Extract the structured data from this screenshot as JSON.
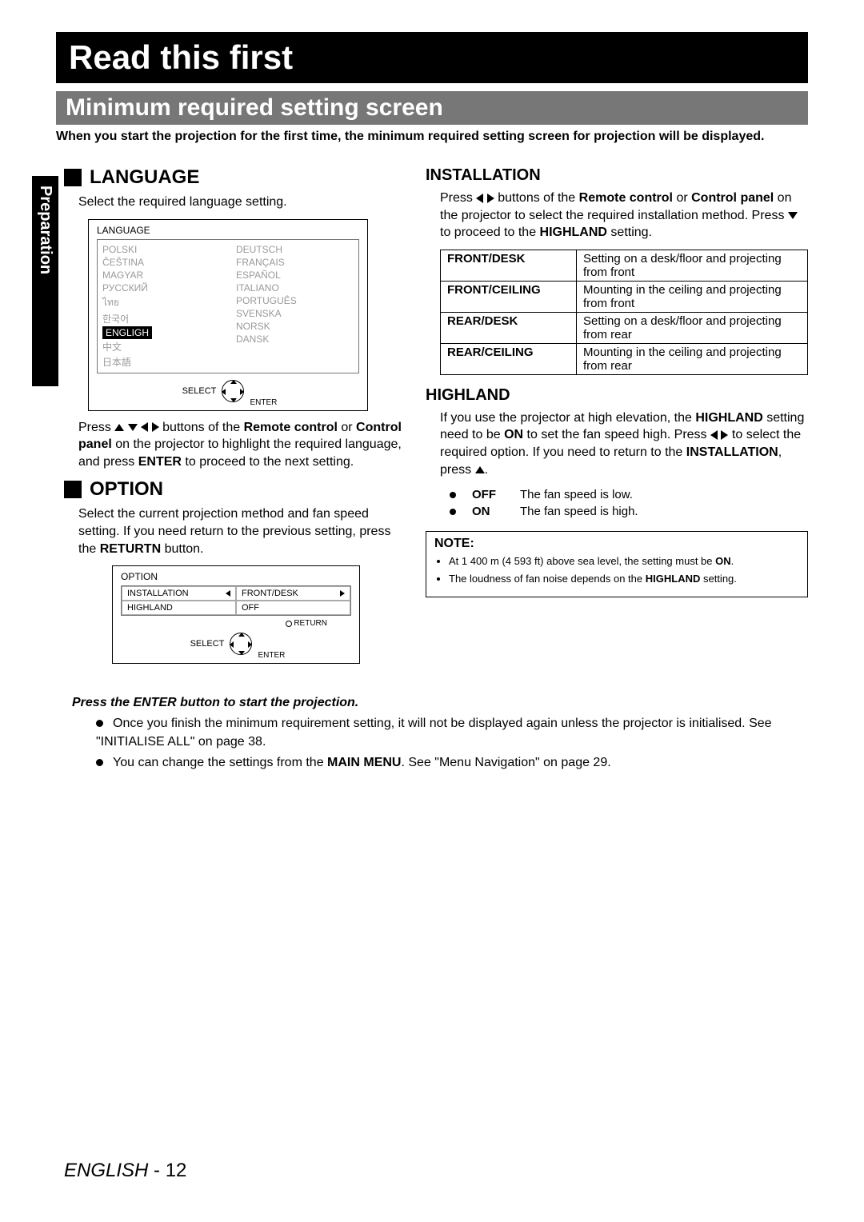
{
  "header": {
    "title": "Read this first",
    "subtitle": "Minimum required setting screen",
    "intro": "When you start the projection for the first time, the minimum required setting screen for projection will be displayed."
  },
  "side_tab": "Preparation",
  "language": {
    "heading": "LANGUAGE",
    "desc": "Select the required language setting.",
    "ui_title": "LANGUAGE",
    "col1": [
      "POLSKI",
      "ČEŠTINA",
      "MAGYAR",
      "РУССКИЙ",
      "ไทย",
      "한국어",
      "ENGLIGH",
      "中文",
      "日本語"
    ],
    "col2": [
      "DEUTSCH",
      "FRANÇAIS",
      "ESPAÑOL",
      "ITALIANO",
      "PORTUGUÊS",
      "SVENSKA",
      "NORSK",
      "DANSK"
    ],
    "select_label": "SELECT",
    "enter_label": "ENTER",
    "post_pre": "Press ",
    "post_mid1": " buttons of the ",
    "post_rc": "Remote control",
    "post_or": " or ",
    "post_cp": "Control panel",
    "post_mid2": " on the projector to highlight the required language, and press ",
    "post_enter": "ENTER",
    "post_end": " to proceed to the next setting."
  },
  "option": {
    "heading": "OPTION",
    "desc": "Select the current projection method and fan speed setting. If you need return to the previous setting, press the ",
    "desc_bold": "RETURTN",
    "desc_end": " button.",
    "ui_title": "OPTION",
    "row1_k": "INSTALLATION",
    "row1_v": "FRONT/DESK",
    "row2_k": "HIGHLAND",
    "row2_v": "OFF",
    "return_label": "RETURN",
    "select_label": "SELECT",
    "enter_label": "ENTER"
  },
  "installation": {
    "heading": "INSTALLATION",
    "p1_pre": "Press ",
    "p1_mid1": " buttons of the ",
    "p1_rc": "Remote control",
    "p1_or": " or ",
    "p1_cp": "Control panel",
    "p1_mid2": " on the projector to select the required installation method. Press ",
    "p1_end1": " to proceed to the ",
    "p1_hl": "HIGHLAND",
    "p1_end2": " setting.",
    "rows": [
      {
        "k": "FRONT/DESK",
        "v": "Setting on a desk/floor and projecting from front"
      },
      {
        "k": "FRONT/CEILING",
        "v": "Mounting in the ceiling and projecting from front"
      },
      {
        "k": "REAR/DESK",
        "v": "Setting on a desk/floor and projecting from rear"
      },
      {
        "k": "REAR/CEILING",
        "v": "Mounting in the ceiling and projecting from rear"
      }
    ]
  },
  "highland": {
    "heading": "HIGHLAND",
    "p_pre": "If you use the projector at high elevation, the ",
    "p_hl": "HIGHLAND",
    "p_mid1": " setting need to be ",
    "p_on": "ON",
    "p_mid2": " to set the fan speed high. Press ",
    "p_mid3": " to select the required option. If you need to return to the ",
    "p_inst": "INSTALLATION",
    "p_mid4": ", press ",
    "p_end": ".",
    "off_lbl": "OFF",
    "off_txt": "The fan speed is low.",
    "on_lbl": "ON",
    "on_txt": "The fan speed is high."
  },
  "note": {
    "title": "NOTE:",
    "items": [
      "At 1 400 m (4 593 ft) above sea level, the setting must be ",
      "The loudness of fan noise depends on the "
    ],
    "n1_bold": "ON",
    "n1_end": ".",
    "n2_bold": "HIGHLAND",
    "n2_end": " setting."
  },
  "footer": {
    "lead": "Press the ENTER button to start the projection.",
    "b1_pre": "Once you finish the minimum requirement setting, it will not be displayed again unless the projector is initialised. See \"INITIALISE ALL\" on page 38.",
    "b2_pre": "You can change the settings from the ",
    "b2_bold": "MAIN MENU",
    "b2_end": ". See \"Menu Navigation\" on page 29."
  },
  "page_foot": {
    "lang": "ENGLISH",
    "sep": " - ",
    "num": "12"
  }
}
